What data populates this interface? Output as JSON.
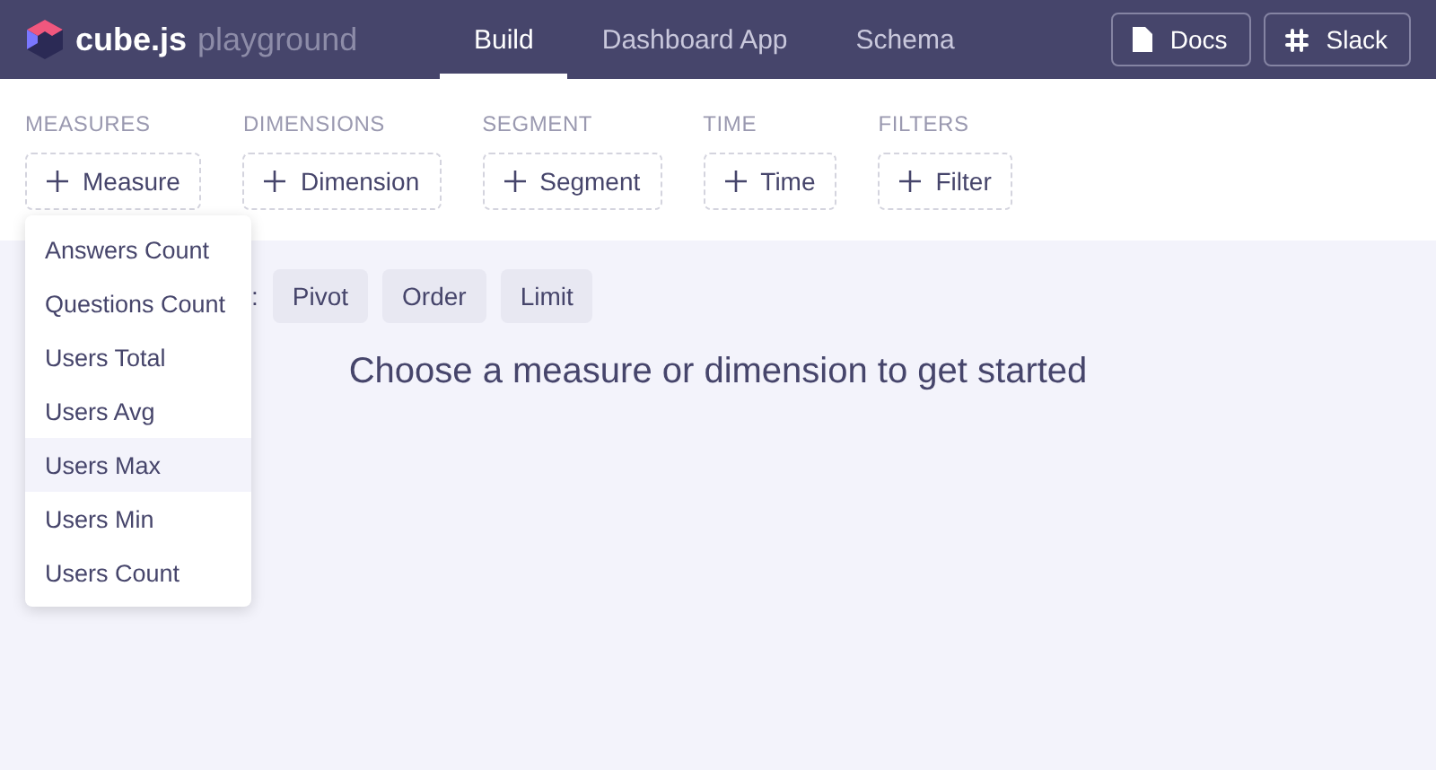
{
  "logo": {
    "name": "cube.js",
    "subtitle": "playground"
  },
  "nav_tabs": [
    {
      "label": "Build",
      "selected": true
    },
    {
      "label": "Dashboard App",
      "selected": false
    },
    {
      "label": "Schema",
      "selected": false
    }
  ],
  "header_buttons": [
    {
      "kind": "docs",
      "label": "Docs"
    },
    {
      "kind": "slack",
      "label": "Slack"
    }
  ],
  "sections": [
    {
      "title": "MEASURES",
      "button": "Measure"
    },
    {
      "title": "DIMENSIONS",
      "button": "Dimension"
    },
    {
      "title": "SEGMENT",
      "button": "Segment"
    },
    {
      "title": "TIME",
      "button": "Time"
    },
    {
      "title": "FILTERS",
      "button": "Filter"
    }
  ],
  "settings": {
    "label": ":",
    "buttons": [
      "Pivot",
      "Order",
      "Limit"
    ]
  },
  "message": "Choose a measure or dimension to get started",
  "measure_menu": {
    "items": [
      {
        "label": "Answers Count",
        "selected": false
      },
      {
        "label": "Questions Count",
        "selected": false
      },
      {
        "label": "Users Total",
        "selected": false
      },
      {
        "label": "Users Avg",
        "selected": false
      },
      {
        "label": "Users Max",
        "selected": true
      },
      {
        "label": "Users Min",
        "selected": false
      },
      {
        "label": "Users Count",
        "selected": false
      }
    ]
  }
}
